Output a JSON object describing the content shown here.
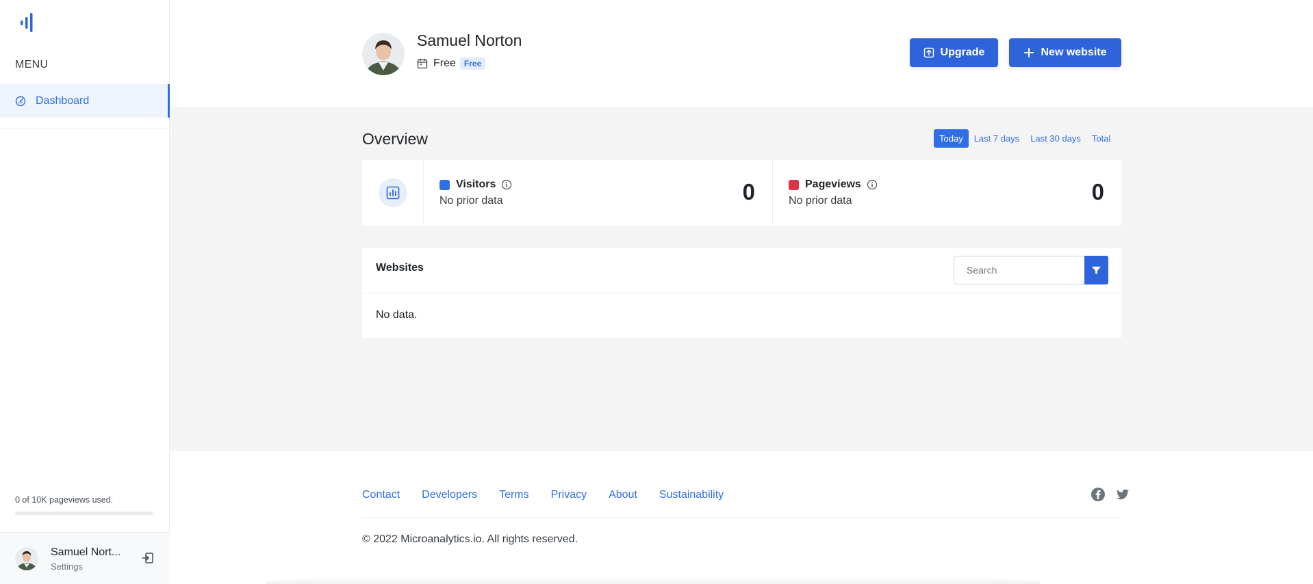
{
  "sidebar": {
    "menu_label": "MENU",
    "nav": [
      {
        "label": "Dashboard",
        "icon": "dashboard-gauge-icon"
      }
    ],
    "usage_text": "0 of 10K pageviews used.",
    "usage_fraction": 0,
    "user": {
      "name": "Samuel Nort...",
      "settings_label": "Settings"
    }
  },
  "header": {
    "profile_name": "Samuel Norton",
    "plan_text": "Free",
    "plan_badge": "Free",
    "upgrade_label": "Upgrade",
    "new_website_label": "New website"
  },
  "overview": {
    "title": "Overview",
    "ranges": [
      "Today",
      "Last 7 days",
      "Last 30 days",
      "Total"
    ],
    "active_range": "Today",
    "stats": [
      {
        "label": "Visitors",
        "sub": "No prior data",
        "value": "0",
        "color": "#2f6fe4"
      },
      {
        "label": "Pageviews",
        "sub": "No prior data",
        "value": "0",
        "color": "#dc3545"
      }
    ]
  },
  "websites": {
    "title": "Websites",
    "search_placeholder": "Search",
    "empty_text": "No data."
  },
  "footer": {
    "links": [
      "Contact",
      "Developers",
      "Terms",
      "Privacy",
      "About",
      "Sustainability"
    ],
    "social": [
      "facebook-icon",
      "twitter-icon"
    ],
    "copyright": "© 2022 Microanalytics.io. All rights reserved."
  },
  "colors": {
    "primary": "#2f6fe4",
    "button": "#2f63db",
    "visitors": "#2f6fe4",
    "pageviews": "#dc3545",
    "background": "#f4f4f4"
  }
}
